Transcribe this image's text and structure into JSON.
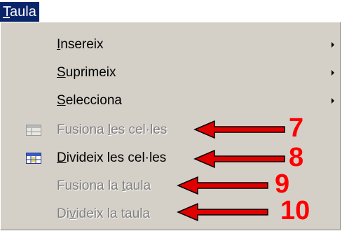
{
  "menu": {
    "title": {
      "mnemonic": "T",
      "rest": "aula"
    },
    "items": [
      {
        "mnemonic": "I",
        "rest": "nsereix",
        "enabled": true,
        "has_submenu": true
      },
      {
        "mnemonic": "S",
        "rest": "uprimeix",
        "enabled": true,
        "has_submenu": true
      },
      {
        "mnemonic": "S",
        "rest": "elecciona",
        "enabled": true,
        "has_submenu": true
      },
      {
        "before": "Fusiona ",
        "mnemonic": "l",
        "rest": "es cel·les",
        "enabled": false,
        "icon": "merge-cells-icon"
      },
      {
        "before": "",
        "mnemonic": "D",
        "rest": "ivideix les cel·les",
        "enabled": true,
        "icon": "split-cells-icon"
      },
      {
        "before": "Fusiona la ",
        "mnemonic": "t",
        "rest": "aula",
        "enabled": false
      },
      {
        "before": "Di",
        "mnemonic": "v",
        "rest": "ideix la taula",
        "enabled": false
      }
    ]
  },
  "annotations": [
    {
      "number": "7",
      "color": "#ff0000"
    },
    {
      "number": "8",
      "color": "#ff0000"
    },
    {
      "number": "9",
      "color": "#ff0000"
    },
    {
      "number": "10",
      "color": "#ff0000"
    }
  ],
  "colors": {
    "menubar_highlight": "#0a246a",
    "menu_background": "#d4d0c8",
    "disabled_text": "#808080",
    "annotation": "#ff0000"
  }
}
